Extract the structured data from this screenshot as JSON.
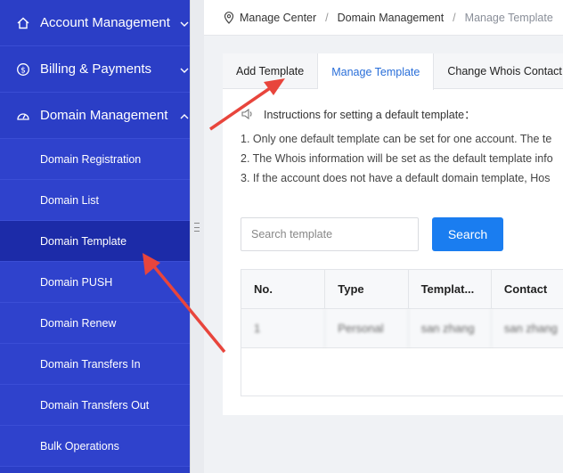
{
  "sidebar": {
    "top_items": [
      {
        "label": "Account Management",
        "icon": "home-icon",
        "chevron": "chevron-down-icon"
      },
      {
        "label": "Billing & Payments",
        "icon": "dollar-icon",
        "chevron": "chevron-down-icon"
      },
      {
        "label": "Domain Management",
        "icon": "gauge-icon",
        "chevron": "chevron-up-icon"
      }
    ],
    "sub_items": [
      {
        "label": "Domain Registration"
      },
      {
        "label": "Domain List"
      },
      {
        "label": "Domain Template"
      },
      {
        "label": "Domain PUSH"
      },
      {
        "label": "Domain Renew"
      },
      {
        "label": "Domain Transfers In"
      },
      {
        "label": "Domain Transfers Out"
      },
      {
        "label": "Bulk Operations"
      }
    ]
  },
  "breadcrumb": {
    "items": [
      "Manage Center",
      "Domain Management",
      "Manage Template"
    ],
    "separator": "/"
  },
  "tabs": [
    "Add Template",
    "Manage Template",
    "Change Whois Contact"
  ],
  "instructions": {
    "title": "Instructions for setting a default template：",
    "lines": [
      "1. Only one default template can be set for one account. The te",
      "2. The Whois information will be set as the default template info",
      "3. If the account does not have a default domain template, Hos"
    ]
  },
  "search": {
    "placeholder": "Search template",
    "button_label": "Search"
  },
  "table": {
    "headers": [
      "No.",
      "Type",
      "Templat...",
      "Contact"
    ],
    "rows": [
      [
        "1",
        "Personal",
        "san zhang",
        "san zhang"
      ]
    ]
  },
  "colors": {
    "sidebar_bg": "#2b3ec6",
    "sidebar_active": "#1c2ba8",
    "accent": "#1a7df0",
    "active_tab_text": "#2a6fd9",
    "annotation_arrow": "#e8453c"
  }
}
